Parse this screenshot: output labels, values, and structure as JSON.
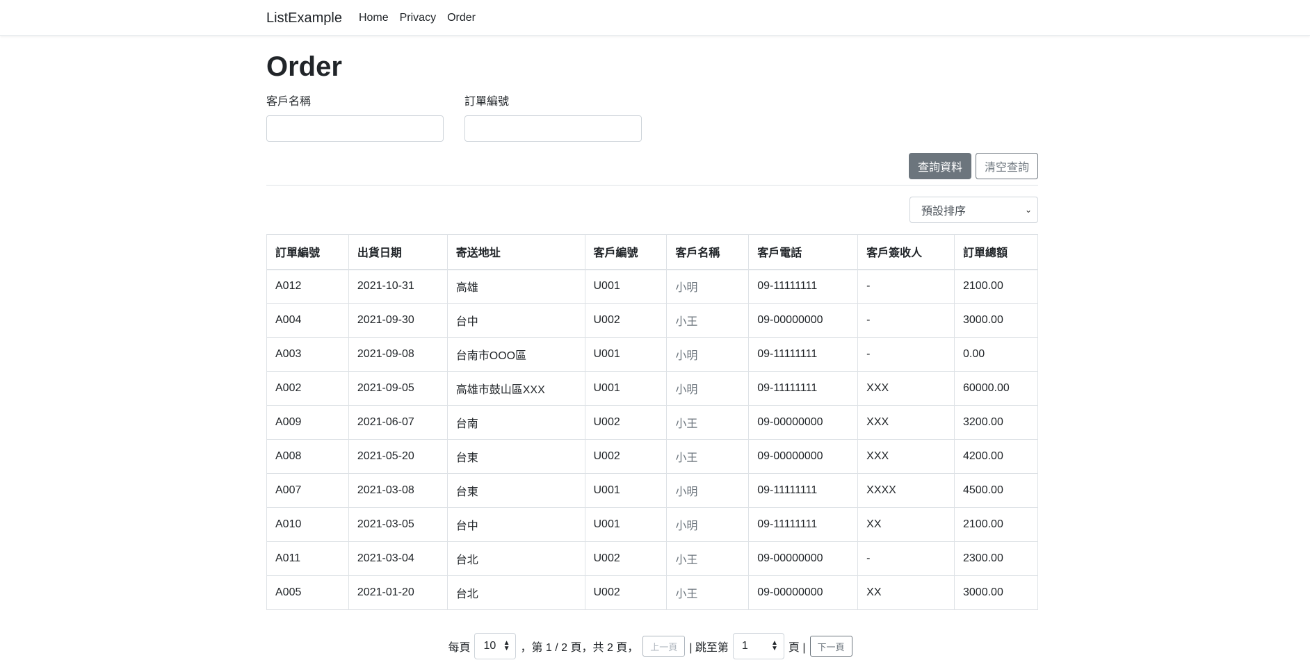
{
  "nav": {
    "brand": "ListExample",
    "links": [
      "Home",
      "Privacy",
      "Order"
    ]
  },
  "page": {
    "title": "Order"
  },
  "filters": {
    "customer_name_label": "客戶名稱",
    "customer_name_value": "",
    "order_no_label": "訂單編號",
    "order_no_value": ""
  },
  "actions": {
    "search_label": "查詢資料",
    "clear_label": "清空查詢"
  },
  "sort": {
    "selected": "預設排序"
  },
  "table": {
    "headers": [
      "訂單編號",
      "出貨日期",
      "寄送地址",
      "客戶編號",
      "客戶名稱",
      "客戶電話",
      "客戶簽收人",
      "訂單總額"
    ],
    "rows": [
      [
        "A012",
        "2021-10-31",
        "高雄",
        "U001",
        "小明",
        "09-11111111",
        "-",
        "2100.00"
      ],
      [
        "A004",
        "2021-09-30",
        "台中",
        "U002",
        "小王",
        "09-00000000",
        "-",
        "3000.00"
      ],
      [
        "A003",
        "2021-09-08",
        "台南市OOO區",
        "U001",
        "小明",
        "09-11111111",
        "-",
        "0.00"
      ],
      [
        "A002",
        "2021-09-05",
        "高雄市鼓山區XXX",
        "U001",
        "小明",
        "09-11111111",
        "XXX",
        "60000.00"
      ],
      [
        "A009",
        "2021-06-07",
        "台南",
        "U002",
        "小王",
        "09-00000000",
        "XXX",
        "3200.00"
      ],
      [
        "A008",
        "2021-05-20",
        "台東",
        "U002",
        "小王",
        "09-00000000",
        "XXX",
        "4200.00"
      ],
      [
        "A007",
        "2021-03-08",
        "台東",
        "U001",
        "小明",
        "09-11111111",
        "XXXX",
        "4500.00"
      ],
      [
        "A010",
        "2021-03-05",
        "台中",
        "U001",
        "小明",
        "09-11111111",
        "XX",
        "2100.00"
      ],
      [
        "A011",
        "2021-03-04",
        "台北",
        "U002",
        "小王",
        "09-00000000",
        "-",
        "2300.00"
      ],
      [
        "A005",
        "2021-01-20",
        "台北",
        "U002",
        "小王",
        "09-00000000",
        "XX",
        "3000.00"
      ]
    ]
  },
  "pager": {
    "per_page_label": "每頁",
    "per_page_value": "10",
    "page_info": "，第 1 / 2 頁，共 2 頁，",
    "prev_label": "上一頁",
    "jump_label": "| 跳至第",
    "jump_value": "1",
    "page_suffix": "頁 |",
    "next_label": "下一頁"
  },
  "colors": {
    "primary_button": "#6c757d",
    "border": "#dee2e6"
  }
}
